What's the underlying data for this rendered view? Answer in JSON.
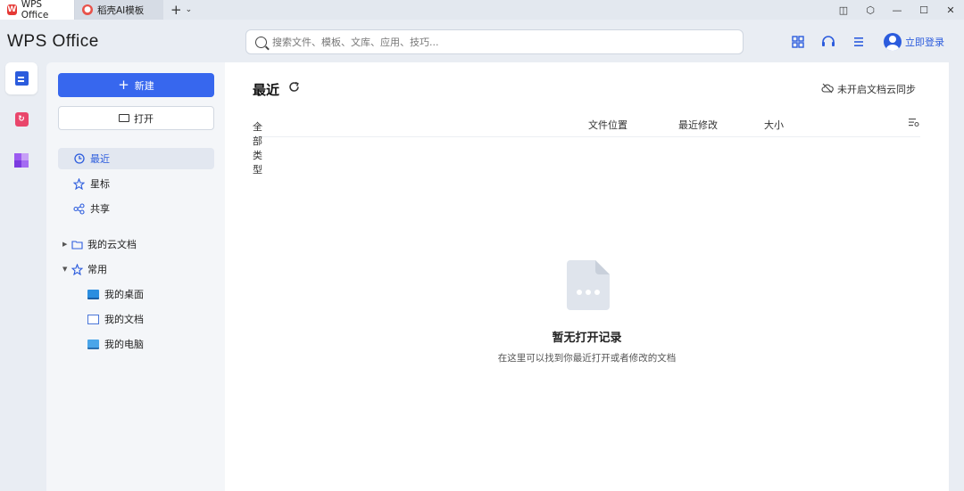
{
  "tabs": [
    {
      "label": "WPS Office",
      "icon": "wps-logo-icon",
      "active": true
    },
    {
      "label": "稻壳AI模板",
      "icon": "docer-icon",
      "active": false
    }
  ],
  "tab_add": "+",
  "tab_dropdown": "⌄",
  "window_controls": [
    "◫",
    "⬡",
    "—",
    "☐",
    "✕"
  ],
  "brand": "WPS Office",
  "search": {
    "placeholder": "搜索文件、模板、文库、应用、技巧..."
  },
  "header_icons": [
    "grid-icon",
    "headset-icon",
    "menu-icon"
  ],
  "login": {
    "label": "立即登录"
  },
  "rail": [
    {
      "icon": "document-icon",
      "active": true
    },
    {
      "icon": "pdf-icon",
      "active": false
    },
    {
      "icon": "apps-icon",
      "active": false
    }
  ],
  "sidebar": {
    "new_label": "新建",
    "open_label": "打开",
    "nav": [
      {
        "label": "最近",
        "icon": "clock-icon",
        "active": true
      },
      {
        "label": "星标",
        "icon": "star-icon",
        "active": false
      },
      {
        "label": "共享",
        "icon": "share-icon",
        "active": false
      }
    ],
    "tree": [
      {
        "label": "我的云文档",
        "expanded": false
      },
      {
        "label": "常用",
        "expanded": true
      }
    ],
    "common": [
      {
        "label": "我的桌面",
        "icon": "desktop-icon"
      },
      {
        "label": "我的文档",
        "icon": "documents-icon"
      },
      {
        "label": "我的电脑",
        "icon": "computer-icon"
      }
    ]
  },
  "main": {
    "title": "最近",
    "cloud_sync": "未开启文档云同步",
    "columns": {
      "type": "全部类型",
      "location": "文件位置",
      "modified": "最近修改",
      "size": "大小"
    },
    "empty_title": "暂无打开记录",
    "empty_desc": "在这里可以找到你最近打开或者修改的文档"
  },
  "colors": {
    "accent": "#3767ee",
    "link": "#2c5cdd",
    "background": "#e9edf3"
  }
}
